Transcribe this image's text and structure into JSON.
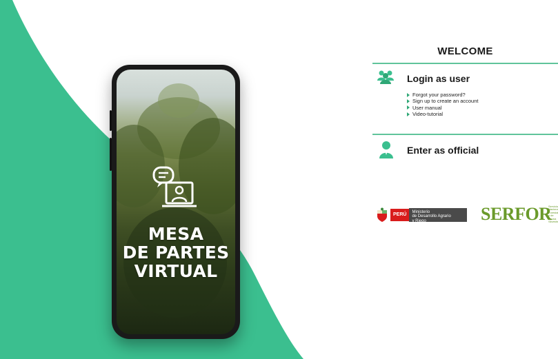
{
  "phone": {
    "title_lines": [
      "MESA",
      "DE PARTES",
      "VIRTUAL"
    ]
  },
  "panel": {
    "welcome": "WELCOME",
    "login_user": {
      "title": "Login as user",
      "links": [
        "Forgot your password?",
        "Sign up to create an account",
        "User manual",
        "Video-tutorial"
      ]
    },
    "official": {
      "title": "Enter as official"
    }
  },
  "logos": {
    "minagri": {
      "peru": "PERÚ",
      "line1": "Ministerio",
      "line2": "de Desarrollo Agrario",
      "line3": "y Riego"
    },
    "serfor": {
      "name": "SERFOR",
      "small_lines": [
        "Servicio",
        "Nacional",
        "Forestal",
        "y de Fauna",
        "Silvestre"
      ]
    }
  },
  "colors": {
    "accent_green": "#3bbf8f",
    "divider": "#5fc49a",
    "serfor_green": "#6a9a2a",
    "peru_red": "#d91c1c"
  },
  "icons": {
    "users": "users-group-icon",
    "user": "user-official-icon",
    "illustration": "chat-user-screen-icon"
  }
}
